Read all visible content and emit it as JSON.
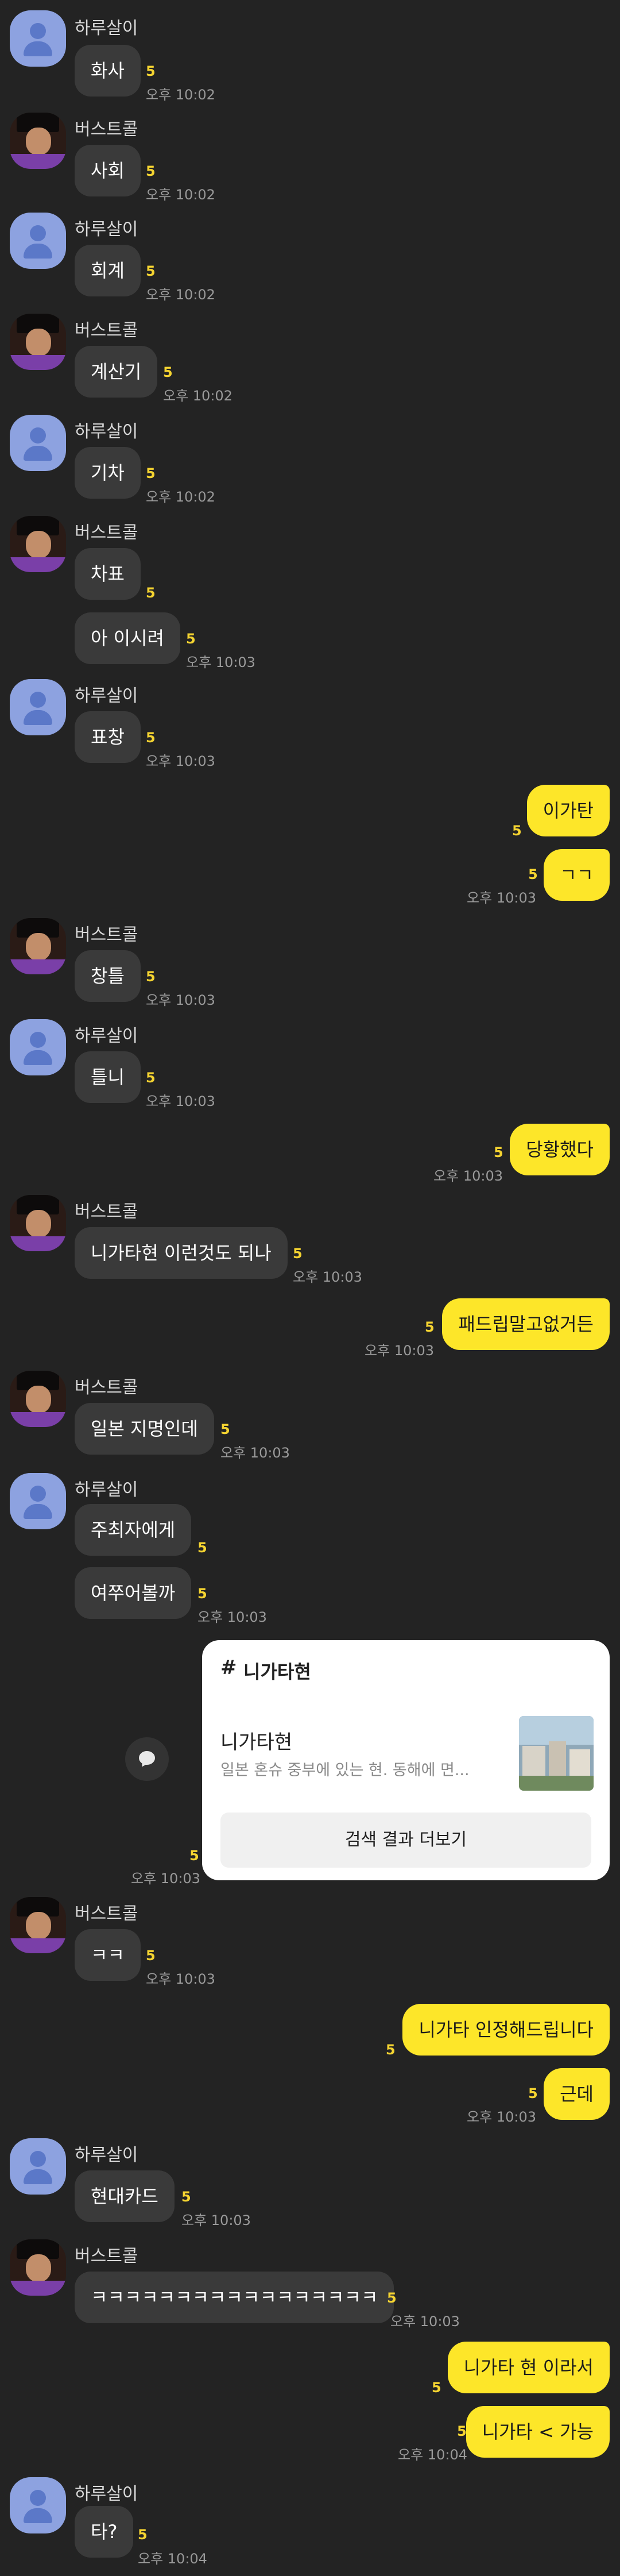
{
  "participants": {
    "haru": "하루살이",
    "burst": "버스트콜"
  },
  "unread": "5",
  "messages": {
    "m1": {
      "text": "화사",
      "time": "오후 10:02"
    },
    "m2": {
      "text": "사회",
      "time": "오후 10:02"
    },
    "m3": {
      "text": "회계",
      "time": "오후 10:02"
    },
    "m4": {
      "text": "계산기",
      "time": "오후 10:02"
    },
    "m5": {
      "text": "기차",
      "time": "오후 10:02"
    },
    "m6a": {
      "text": "차표"
    },
    "m6b": {
      "text": "아 이시려",
      "time": "오후 10:03"
    },
    "m7": {
      "text": "표창",
      "time": "오후 10:03"
    },
    "m8a": {
      "text": "이가탄"
    },
    "m8b": {
      "text": "ㄱㄱ",
      "time": "오후 10:03"
    },
    "m9": {
      "text": "창틀",
      "time": "오후 10:03"
    },
    "m10": {
      "text": "틀니",
      "time": "오후 10:03"
    },
    "m11": {
      "text": "당황했다",
      "time": "오후 10:03"
    },
    "m12": {
      "text": "니가타현 이런것도 되나",
      "time": "오후 10:03"
    },
    "m13": {
      "text": "패드립말고없거든",
      "time": "오후 10:03"
    },
    "m14": {
      "text": "일본 지명인데",
      "time": "오후 10:03"
    },
    "m15a": {
      "text": "주최자에게"
    },
    "m15b": {
      "text": "여쭈어볼까",
      "time": "오후 10:03"
    },
    "m17": {
      "text": "ㅋㅋ",
      "time": "오후 10:03"
    },
    "m18a": {
      "text": "니가타 인정해드립니다"
    },
    "m18b": {
      "text": "근데",
      "time": "오후 10:03"
    },
    "m19": {
      "text": "현대카드",
      "time": "오후 10:03"
    },
    "m20": {
      "text": "ㅋㅋㅋㅋㅋㅋㅋㅋㅋㅋㅋㅋㅋㅋㅋㅋㅋ",
      "time": "오후 10:03"
    },
    "m21a": {
      "text": "니가타 현 이라서"
    },
    "m21b": {
      "text": "니가타 < 가능",
      "time": "오후 10:04"
    },
    "m22": {
      "text": "타?",
      "time": "오후 10:04"
    }
  },
  "search_card": {
    "hash": "#",
    "query": "니가타현",
    "result_title": "니가타현",
    "result_desc": "일본 혼슈 중부에 있는 현. 동해에 면...",
    "more_label": "검색 결과 더보기",
    "time": "오후 10:03",
    "share_icon": "chat-bubble-icon",
    "thumb_icon": "city-photo"
  },
  "colors": {
    "background": "#232323",
    "incoming_bubble": "#3a3a3a",
    "outgoing_bubble": "#fde629",
    "unread": "#f5d431",
    "default_avatar": "#8da2e0"
  }
}
